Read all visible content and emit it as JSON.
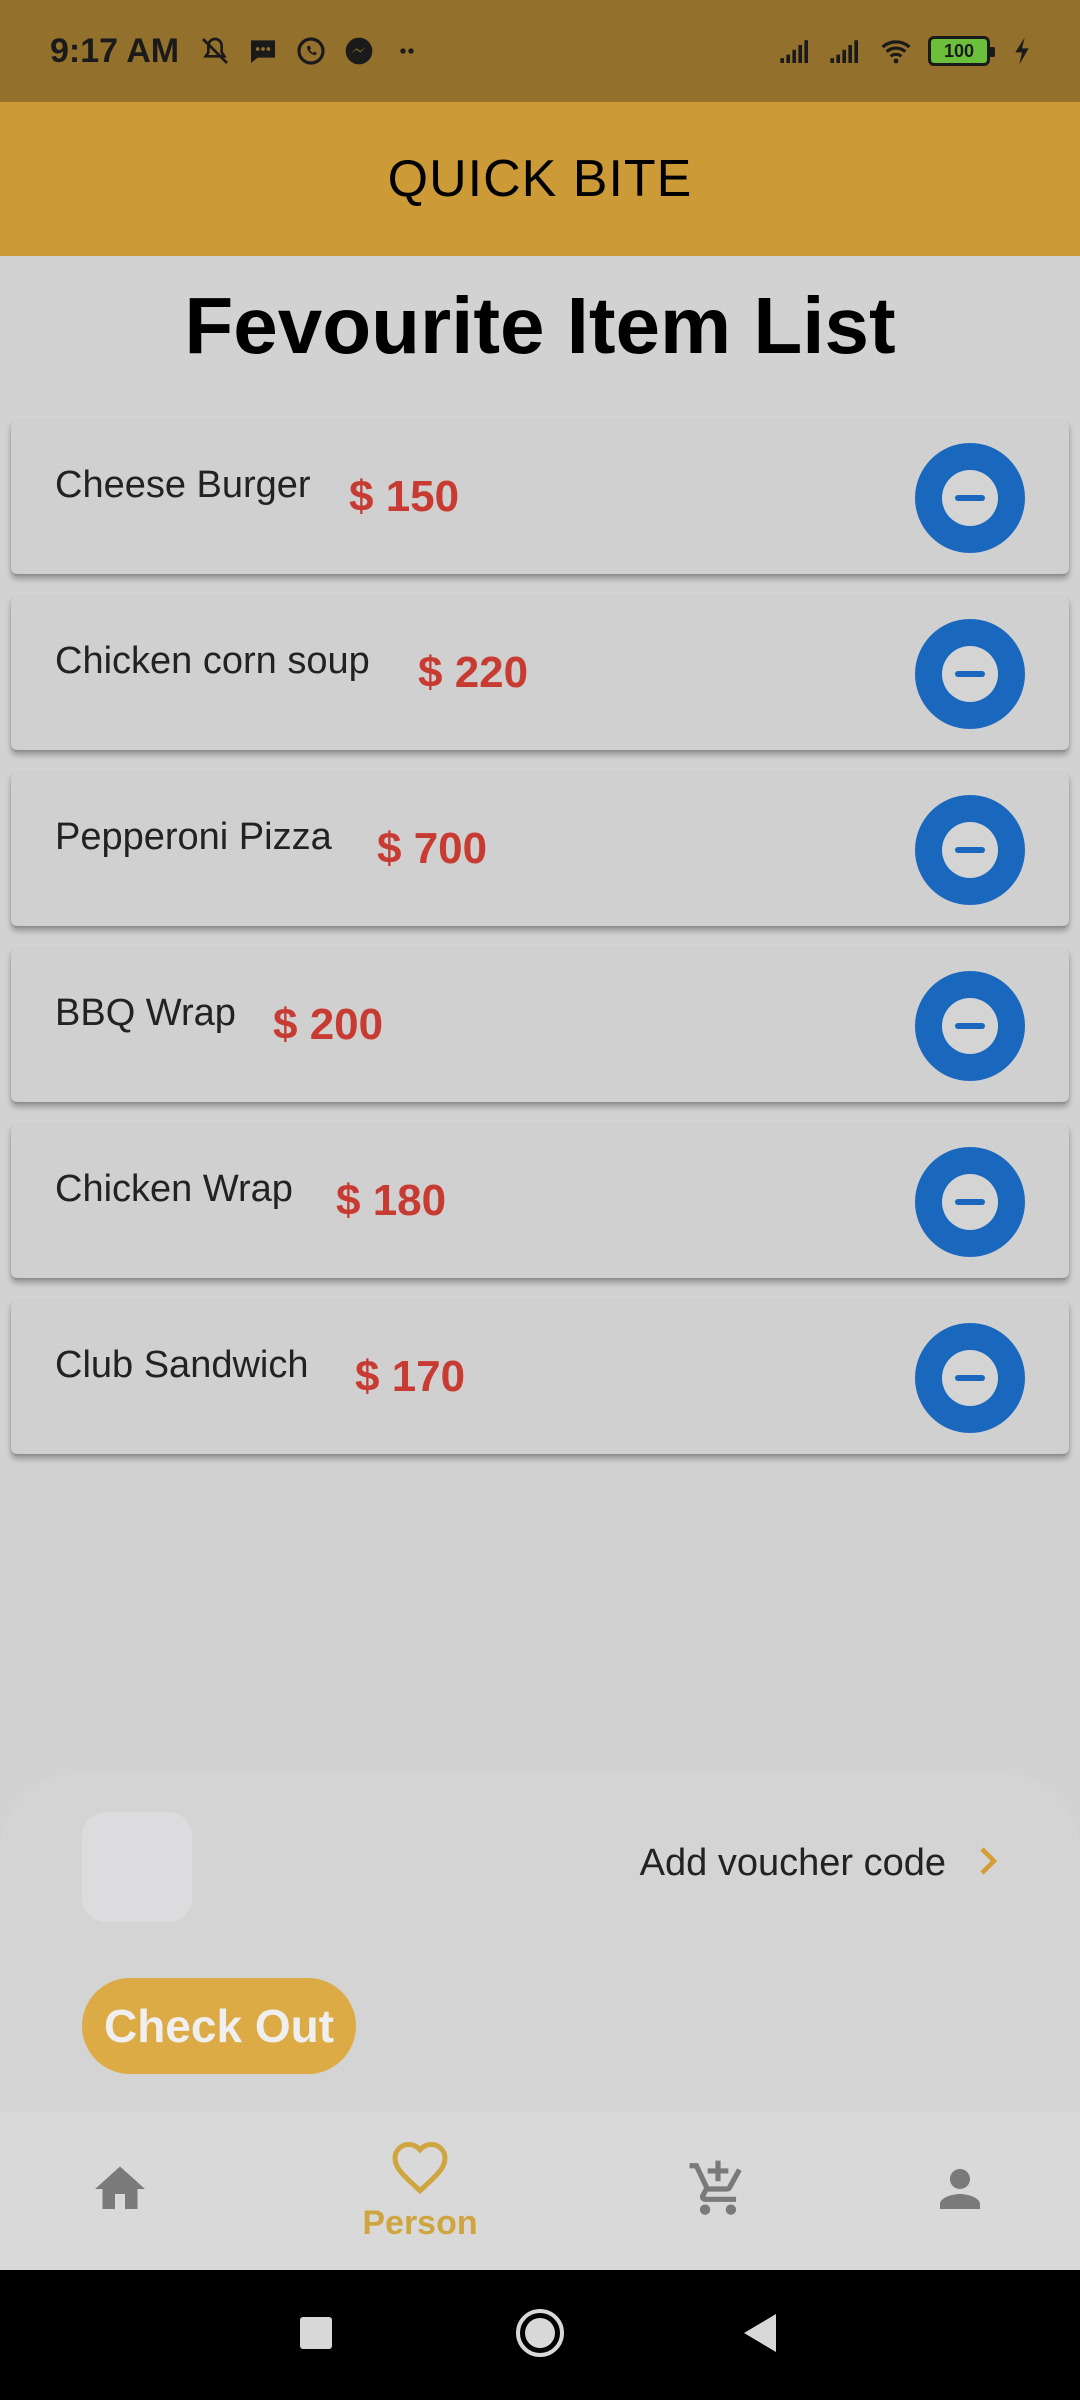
{
  "status_bar": {
    "time": "9:17 AM",
    "battery": "100",
    "icons": [
      "mute-bell-icon",
      "message-icon",
      "whatsapp-icon",
      "messenger-icon",
      "more-dots-icon",
      "signal-icon",
      "signal-icon",
      "wifi-icon",
      "battery-icon",
      "charging-icon"
    ]
  },
  "app_bar": {
    "title": "QUICK BITE"
  },
  "page": {
    "title": "Fevourite Item List"
  },
  "favourites": [
    {
      "name": "Cheese Burger",
      "price": "$ 150"
    },
    {
      "name": "Chicken corn soup",
      "price": "$ 220"
    },
    {
      "name": "Pepperoni Pizza",
      "price": "$ 700"
    },
    {
      "name": "BBQ Wrap",
      "price": "$ 200"
    },
    {
      "name": "Chicken Wrap",
      "price": "$ 180"
    },
    {
      "name": "Club Sandwich",
      "price": "$ 170"
    }
  ],
  "checkout": {
    "voucher_label": "Add voucher code",
    "checkout_label": "Check Out"
  },
  "bottom_nav": {
    "items": [
      {
        "icon": "home-icon",
        "label": ""
      },
      {
        "icon": "heart-icon",
        "label": "Person",
        "active": true
      },
      {
        "icon": "add-cart-icon",
        "label": ""
      },
      {
        "icon": "person-icon",
        "label": ""
      }
    ]
  },
  "colors": {
    "status_bar": "#93702c",
    "app_bar": "#cc9b38",
    "accent": "#dcab45",
    "price": "#c73b32",
    "remove_button": "#1a68be",
    "nav_inactive": "#7a7a7a"
  }
}
